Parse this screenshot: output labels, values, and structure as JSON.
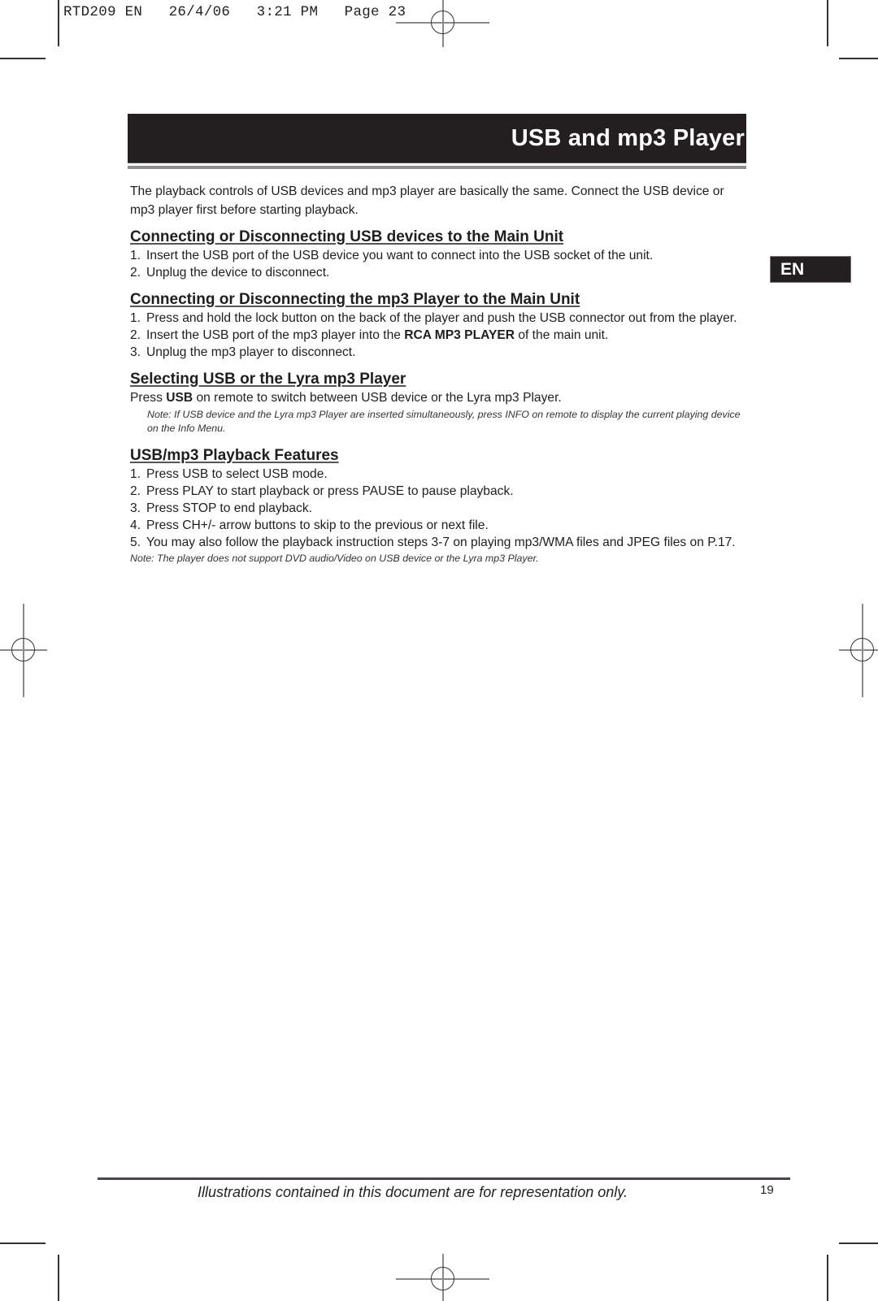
{
  "slug": "RTD209 EN   26/4/06   3:21 PM   Page 23",
  "header": {
    "title": "USB and mp3 Player",
    "language_tab": "EN"
  },
  "intro": "The playback controls of USB devices and mp3 player are basically the same. Connect the USB device or mp3 player first before starting playback.",
  "sections": [
    {
      "heading": "Connecting or Disconnecting USB devices to the Main Unit",
      "steps": [
        {
          "num": "1.",
          "text": "Insert the USB port of the USB device you want to connect into the USB socket of the unit."
        },
        {
          "num": "2.",
          "text": "Unplug the device to disconnect."
        }
      ]
    },
    {
      "heading": "Connecting or Disconnecting the mp3 Player to the Main Unit",
      "steps": [
        {
          "num": "1.",
          "text": "Press and hold the lock button on the back of the player and push the USB connector out from the player."
        },
        {
          "num": "2.",
          "text_before": "Insert the USB port of the mp3 player into the ",
          "bold": "RCA MP3 PLAYER",
          "text_after": " of the main unit."
        },
        {
          "num": "3.",
          "text": "Unplug the mp3 player to disconnect."
        }
      ]
    },
    {
      "heading": "Selecting USB or the Lyra mp3 Player",
      "text_before": "Press ",
      "bold": "USB",
      "text_after": " on remote to switch between USB device or the Lyra mp3 Player.",
      "note": "Note: If  USB device and the Lyra mp3 Player are inserted simultaneously, press INFO on remote to display the current playing device on the Info Menu."
    },
    {
      "heading": "USB/mp3 Playback Features",
      "steps": [
        {
          "num": "1.",
          "text": "Press USB to select USB mode."
        },
        {
          "num": "2.",
          "text": "Press PLAY to start playback or press PAUSE to pause playback."
        },
        {
          "num": "3.",
          "text": "Press STOP to end playback."
        },
        {
          "num": "4.",
          "text": "Press CH+/- arrow buttons to skip to the previous or next file."
        },
        {
          "num": "5.",
          "text": "You may also follow the playback instruction steps 3-7 on playing mp3/WMA files and JPEG files on P.17."
        }
      ],
      "note": "Note: The player does not support DVD audio/Video on USB device or the Lyra mp3 Player."
    }
  ],
  "footer": {
    "disclaimer": "Illustrations contained in this document are for representation only.",
    "page_number": "19"
  }
}
